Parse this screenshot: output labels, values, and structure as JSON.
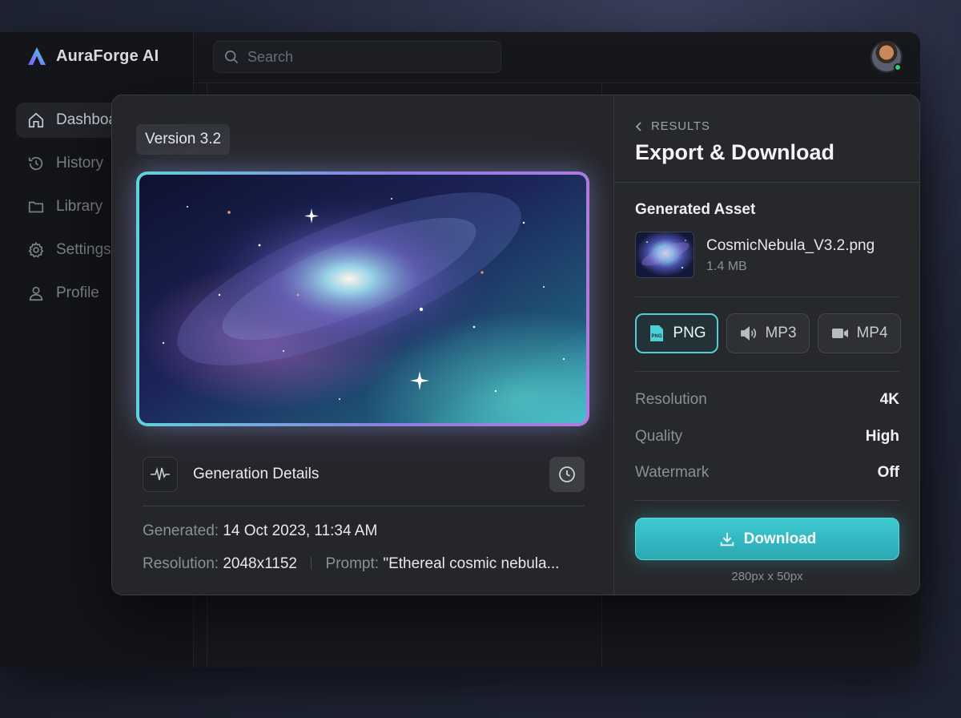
{
  "app": {
    "brand_name": "AuraForge AI"
  },
  "sidebar": {
    "items": [
      {
        "label": "Dashboard",
        "icon": "home-icon",
        "active": true
      },
      {
        "label": "History",
        "icon": "history-icon",
        "active": false
      },
      {
        "label": "Library",
        "icon": "folder-icon",
        "active": false
      },
      {
        "label": "Settings",
        "icon": "gear-icon",
        "active": false
      },
      {
        "label": "Profile",
        "icon": "user-icon",
        "active": false
      }
    ]
  },
  "topbar": {
    "search_placeholder": "Search",
    "user_status": "online"
  },
  "preview": {
    "version_badge": "Version 3.2",
    "details_title": "Generation Details",
    "generated_label": "Generated:",
    "generated_value": "14 Oct 2023, 11:34 AM",
    "resolution_label": "Resolution:",
    "resolution_value": "2048x1152",
    "prompt_label": "Prompt:",
    "prompt_value": "\"Ethereal cosmic nebula..."
  },
  "export_panel": {
    "back_label": "RESULTS",
    "title": "Export & Download",
    "section_label": "Generated Asset",
    "asset_name": "CosmicNebula_V3.2.png",
    "asset_size": "1.4 MB",
    "formats": [
      {
        "label": "PNG",
        "icon": "png-file-icon",
        "selected": true
      },
      {
        "label": "MP3",
        "icon": "speaker-icon",
        "selected": false
      },
      {
        "label": "MP4",
        "icon": "video-camera-icon",
        "selected": false
      }
    ],
    "specs": [
      {
        "label": "Resolution",
        "value": "4K"
      },
      {
        "label": "Quality",
        "value": "High"
      },
      {
        "label": "Watermark",
        "value": "Off"
      }
    ],
    "download_label": "Download",
    "download_caption": "280px x 50px"
  },
  "colors": {
    "accent": "#3fc9d0",
    "background": "#17181c",
    "modal": "#25262a",
    "status_online": "#2fd47a"
  }
}
